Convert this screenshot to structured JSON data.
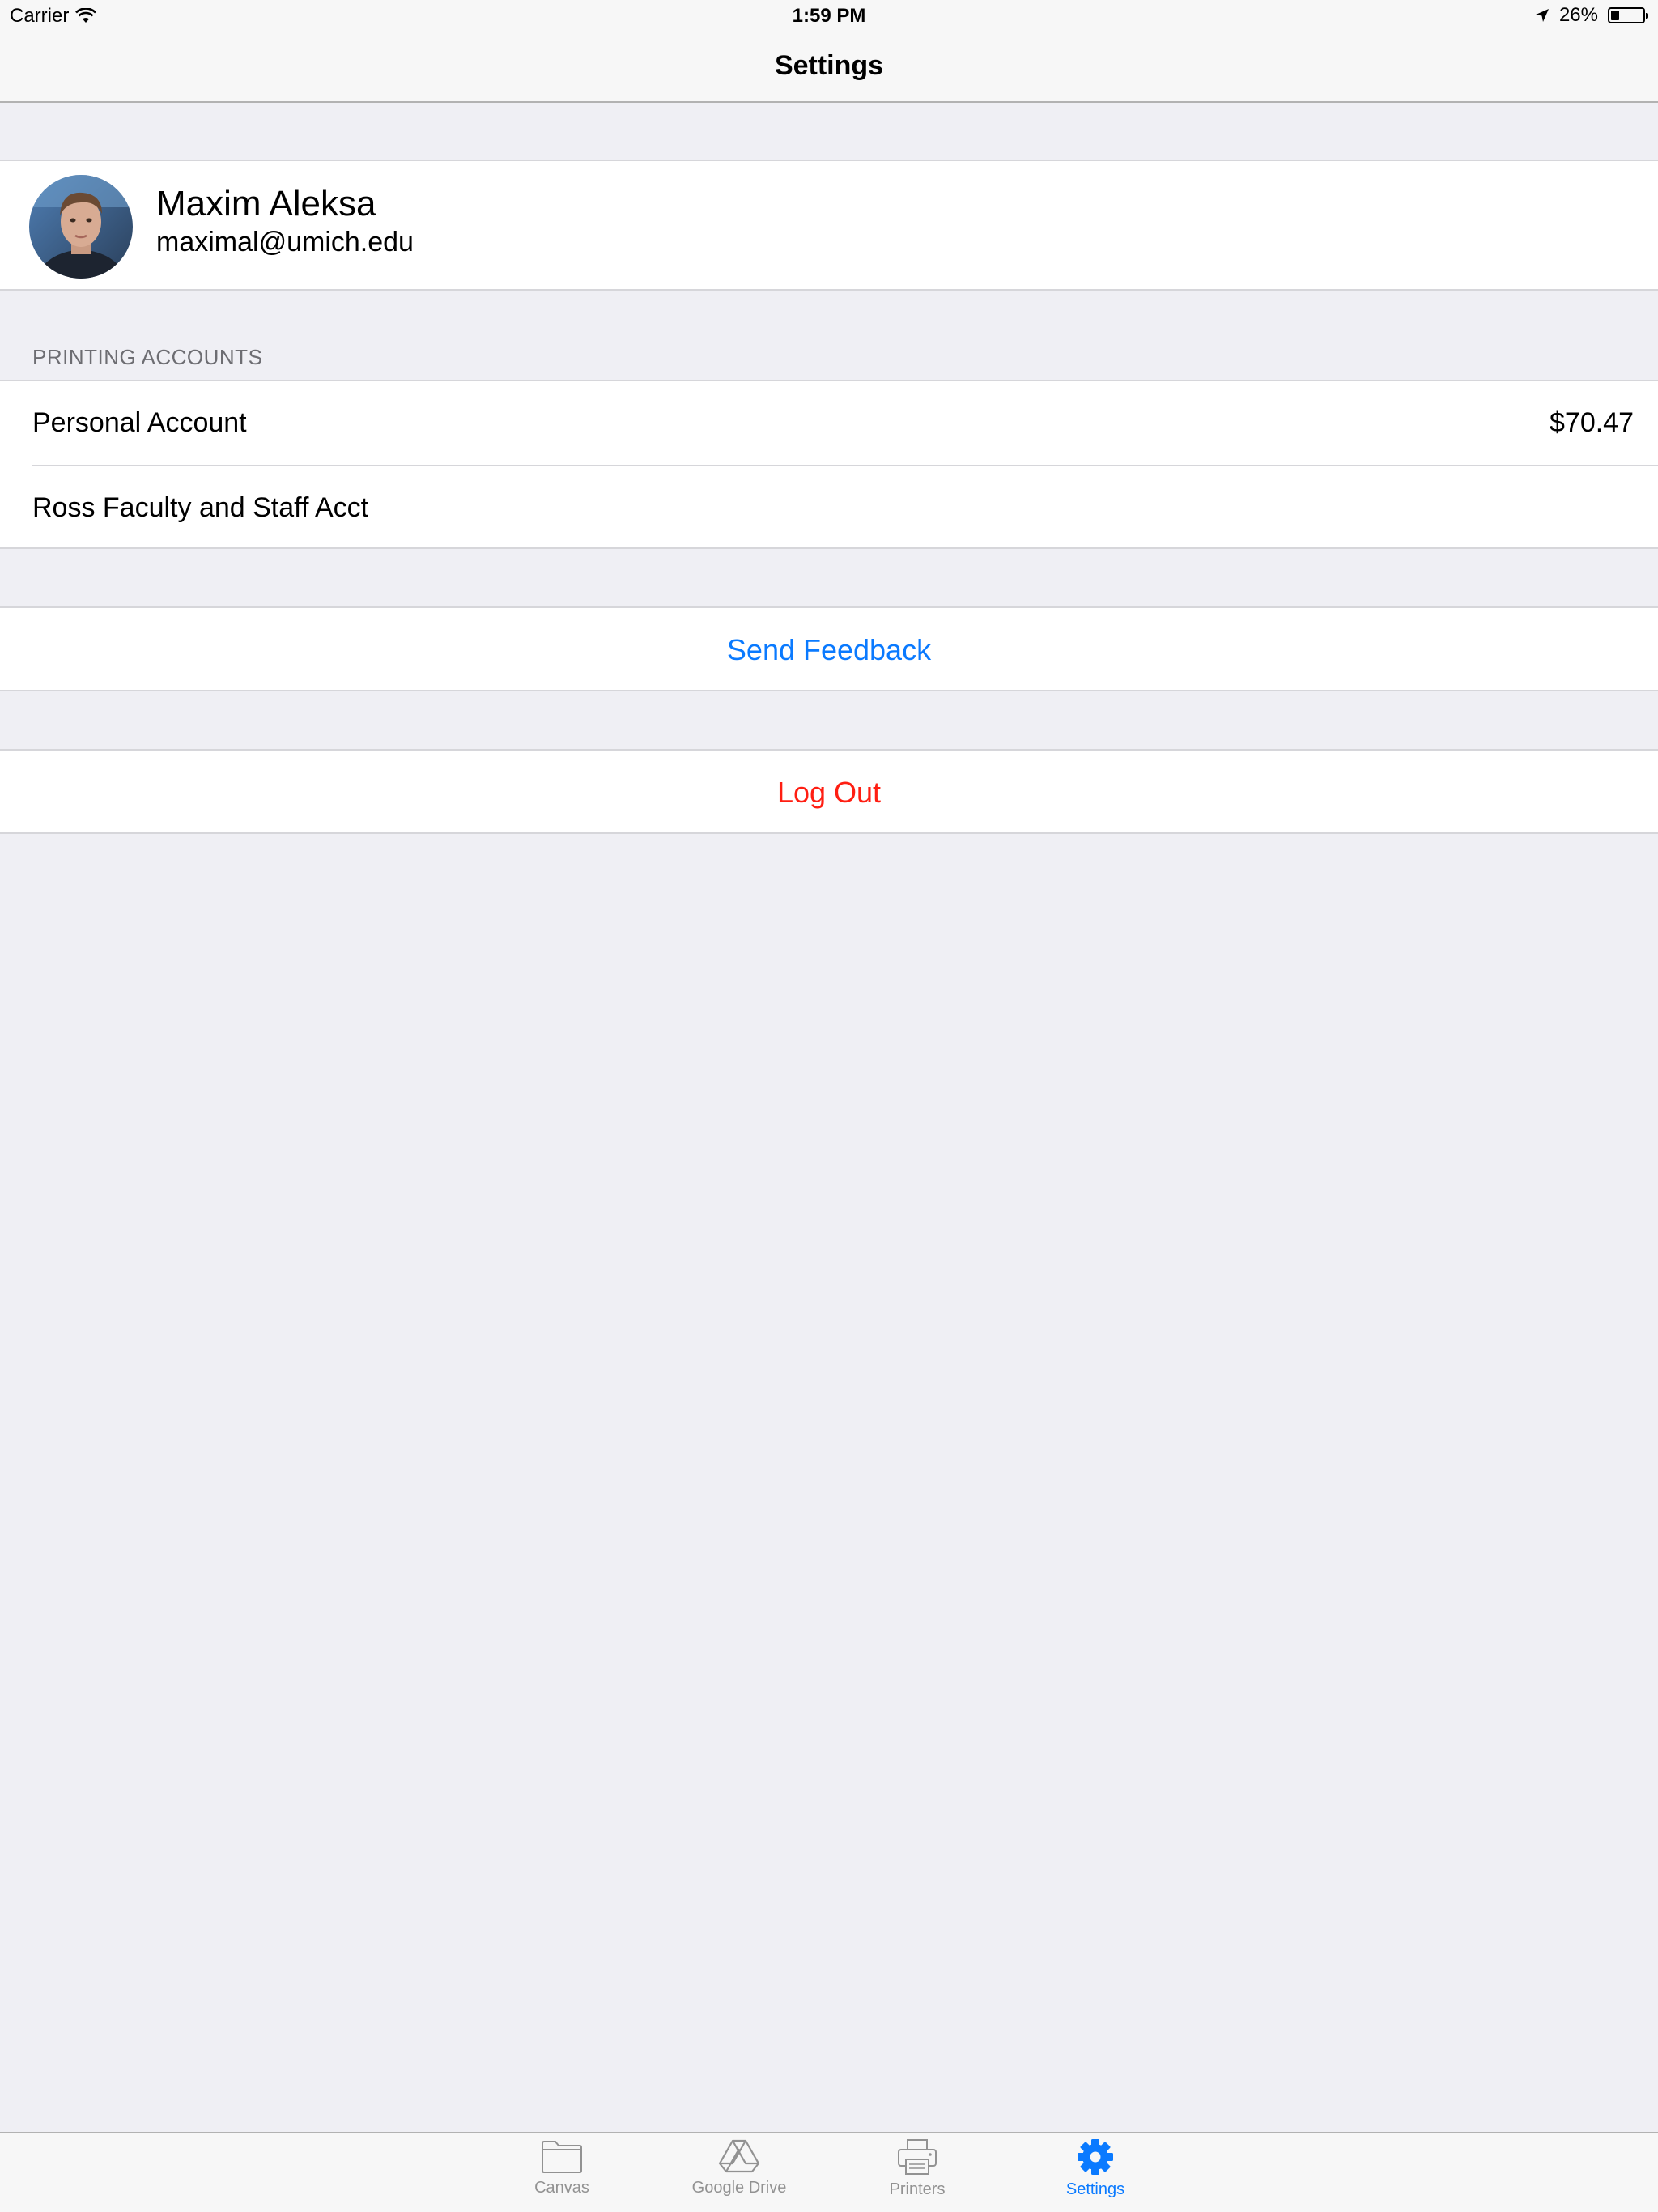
{
  "status_bar": {
    "carrier": "Carrier",
    "time": "1:59 PM",
    "battery_text": "26%",
    "battery_level": 0.26
  },
  "nav": {
    "title": "Settings"
  },
  "profile": {
    "name": "Maxim Aleksa",
    "email": "maximal@umich.edu"
  },
  "printing_accounts": {
    "header": "PRINTING ACCOUNTS",
    "items": [
      {
        "label": "Personal Account",
        "value": "$70.47"
      },
      {
        "label": "Ross Faculty and Staff Acct",
        "value": ""
      }
    ]
  },
  "actions": {
    "feedback_label": "Send Feedback",
    "logout_label": "Log Out"
  },
  "tabs": [
    {
      "label": "Canvas",
      "icon": "folder-icon",
      "active": false
    },
    {
      "label": "Google Drive",
      "icon": "google-drive-icon",
      "active": false
    },
    {
      "label": "Printers",
      "icon": "printer-icon",
      "active": false
    },
    {
      "label": "Settings",
      "icon": "gear-icon",
      "active": true
    }
  ],
  "colors": {
    "accent": "#0a7aff",
    "destructive": "#ff1e12",
    "background": "#efeff4"
  }
}
